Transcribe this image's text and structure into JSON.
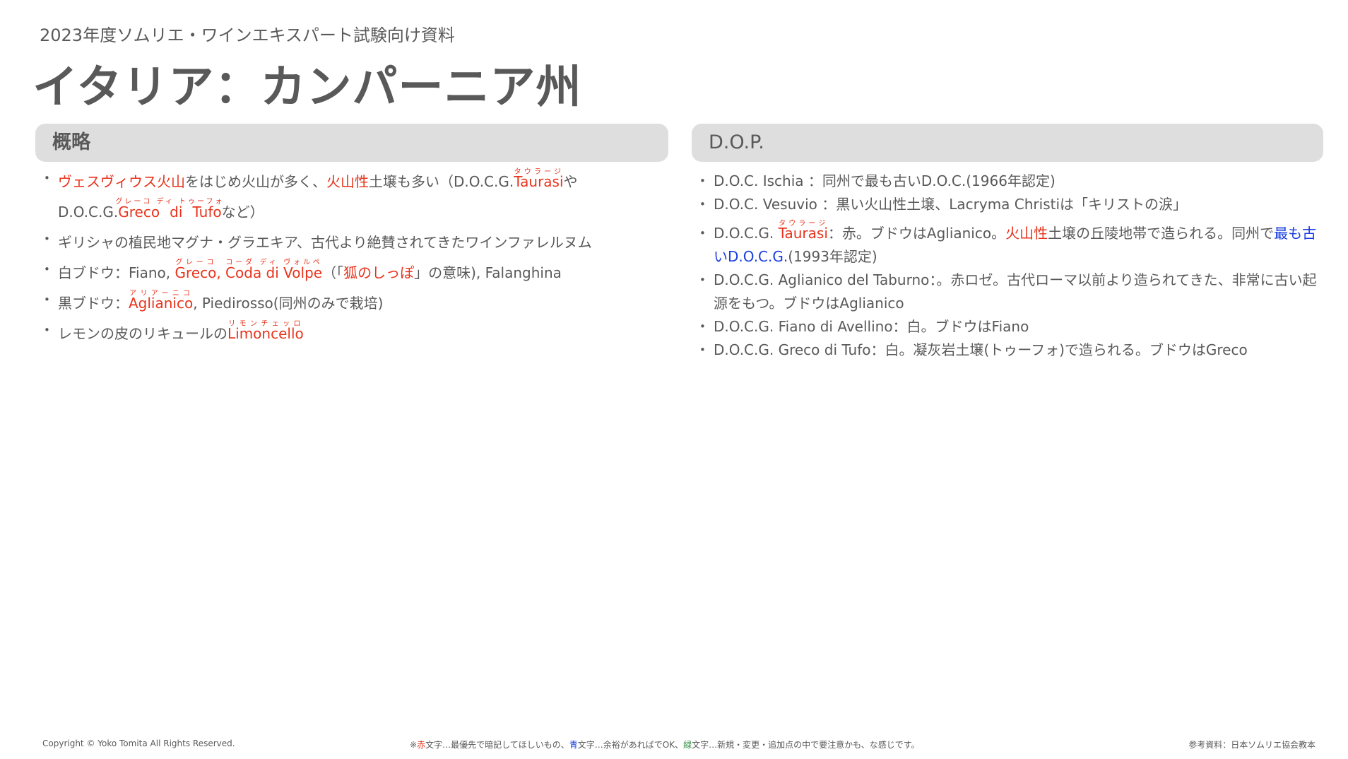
{
  "header": {
    "subtitle": "2023年度ソムリエ・ワインエキスパート試験向け資料",
    "title": "イタリア：カンパーニア州"
  },
  "left": {
    "heading": "概略",
    "items": [
      {
        "a": "ヴェスヴィウス火山",
        "b": "をはじめ火山が多く、",
        "c": "火山性",
        "d": "土壌も多い（D.O.C.G.",
        "e": "Taurasi",
        "e_rt": "タウラージ",
        "f": "や",
        "g": "D.O.C.G.",
        "h": "Greco di  Tufo",
        "h_rt": "グレーコ ディ トゥーフォ",
        "i": "など）"
      },
      {
        "a": "ギリシャの植民地マグナ・グラエキア、古代より絶賛されてきたワインファレルヌム"
      },
      {
        "a": "白ブドウ：Fiano, ",
        "b": "Greco",
        "b_rt": "グレーコ",
        "c": ", ",
        "d": "Coda di Volpe",
        "d_rt": "コーダ ディ ヴォルペ",
        "e": "（「",
        "f": "狐のしっぽ",
        "g": "」の意味), Falanghina"
      },
      {
        "a": "黒ブドウ：",
        "b": "Aglianico",
        "b_rt": "アリアーニコ",
        "c": ", Piedirosso(同州のみで栽培)"
      },
      {
        "a": "レモンの皮のリキュールの",
        "b": "Limoncello",
        "b_rt": "リモンチェッロ"
      }
    ]
  },
  "right": {
    "heading": "D.O.P.",
    "items": [
      {
        "a": "D.O.C. Ischia ：同州で最も古いD.O.C.(1966年認定)"
      },
      {
        "a": "D.O.C. Vesuvio ：黒い火山性土壌、Lacryma Christiは「キリストの涙」"
      },
      {
        "a": "D.O.C.G. ",
        "b": "Taurasi",
        "b_rt": "タウラージ",
        "c": "：赤。ブドウはAglianico。",
        "d": "火山性",
        "e": "土壌の丘陵地帯で造られる。同州で",
        "f": "最も古いD.O.C.G.",
        "g": "(1993年認定)"
      },
      {
        "a": "D.O.C.G. Aglianico del Taburno：。赤ロゼ。古代ローマ以前より造られてきた、非常に古い起源をもつ。ブドウはAglianico"
      },
      {
        "a": "D.O.C.G. Fiano di Avellino：白。ブドウはFiano"
      },
      {
        "a": "D.O.C.G. Greco di Tufo：白。凝灰岩土壌(トゥーフォ)で造られる。ブドウはGreco"
      }
    ]
  },
  "footer": {
    "copyright": "Copyright © Yoko Tomita All Rights Reserved.",
    "legend": {
      "p1": "※",
      "red_word": "赤",
      "p2": "文字…最優先で暗記してほしいもの、",
      "blue_word": "青",
      "p3": "文字…余裕があればでOK、",
      "green_word": "緑",
      "p4": "文字…新規・変更・追加点の中で要注意かも、な感じです。"
    },
    "reference": "参考資料：日本ソムリエ協会教本"
  },
  "colors": {
    "red": "#e8331c",
    "blue": "#1a3ee0",
    "green": "#2e8b3e",
    "text": "#595959",
    "panel": "#dedede"
  }
}
